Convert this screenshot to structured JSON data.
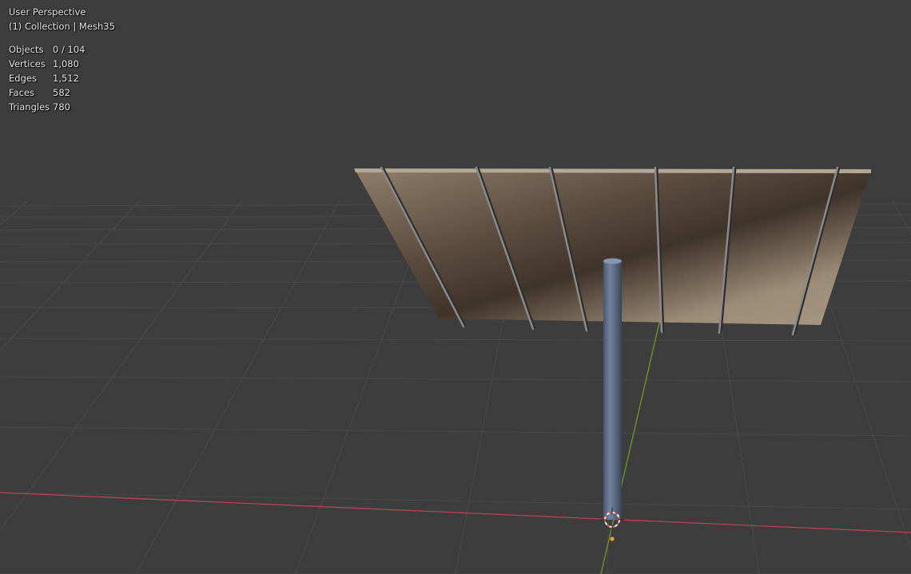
{
  "viewport": {
    "view_name": "User Perspective",
    "collection_line": "(1) Collection | Mesh35",
    "stats": [
      {
        "label": "Objects",
        "value": "0 / 104"
      },
      {
        "label": "Vertices",
        "value": "1,080"
      },
      {
        "label": "Edges",
        "value": "1,512"
      },
      {
        "label": "Faces",
        "value": "582"
      },
      {
        "label": "Triangles",
        "value": "780"
      }
    ]
  },
  "colors": {
    "background": "#3d3d3d",
    "grid": "#4a4a4a",
    "x_axis": "#b8454f",
    "y_axis": "#6d9a2c",
    "panel_light": "#9e8e7a",
    "panel_dark": "#3e342c",
    "pole": "#5c6b80",
    "cursor_red": "#e05050",
    "origin_dot": "#f0a030"
  },
  "icons": {
    "cursor": "3d-cursor-icon",
    "origin": "origin-dot-icon"
  }
}
